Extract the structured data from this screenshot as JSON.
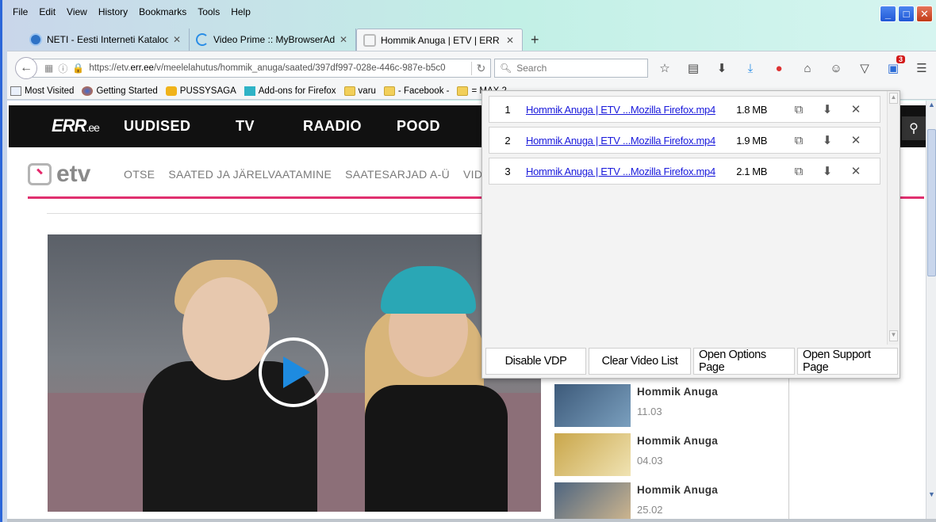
{
  "menu": [
    "File",
    "Edit",
    "View",
    "History",
    "Bookmarks",
    "Tools",
    "Help"
  ],
  "tabs": [
    {
      "title": "NETI - Eesti Interneti Kataloo...",
      "color": "#2e72c6"
    },
    {
      "title": "Video Prime :: MyBrowserAdd...",
      "color": "#2a8ee6"
    },
    {
      "title": "Hommik Anuga | ETV | ERR",
      "color": "#e0306f"
    }
  ],
  "urlbar": {
    "prefix": "https://etv.",
    "domain": "err.ee",
    "path": "/v/meelelahutus/hommik_anuga/saated/397df997-028e-446c-987e-b5c0"
  },
  "search": {
    "placeholder": "Search"
  },
  "toolbar": {
    "badge": "3"
  },
  "bookmarks": [
    {
      "label": "Most Visited",
      "type": "page"
    },
    {
      "label": "Getting Started",
      "type": "firefox"
    },
    {
      "label": "PUSSYSAGA",
      "type": "yellow"
    },
    {
      "label": "Add-ons for Firefox",
      "type": "puzzle"
    },
    {
      "label": "varu",
      "type": "folder"
    },
    {
      "label": "- Facebook -",
      "type": "folder"
    },
    {
      "label": "= MAX 2 -",
      "type": "folder"
    }
  ],
  "err": {
    "logo": "ERR",
    "logo_suffix": ".ee",
    "nav": [
      "UUDISED",
      "TV",
      "RAADIO",
      "POOD"
    ]
  },
  "etv": {
    "logo": "etv",
    "nav": [
      "OTSE",
      "SAATED JA JÄRELVAATAMINE",
      "SAATESARJAD A-Ü",
      "VIDEOD"
    ]
  },
  "related": [
    {
      "name": "Hommik Anuga",
      "date": "11.03"
    },
    {
      "name": "Hommik Anuga",
      "date": "04.03"
    },
    {
      "name": "Hommik Anuga",
      "date": "25.02"
    }
  ],
  "downloads": [
    {
      "num": "1",
      "name": "Hommik Anuga | ETV ...Mozilla Firefox.mp4",
      "size": "1.8 MB"
    },
    {
      "num": "2",
      "name": "Hommik Anuga | ETV ...Mozilla Firefox.mp4",
      "size": "1.9 MB"
    },
    {
      "num": "3",
      "name": "Hommik Anuga | ETV ...Mozilla Firefox.mp4",
      "size": "2.1 MB"
    }
  ],
  "popup_buttons": {
    "disable": "Disable VDP",
    "clear": "Clear Video List",
    "options": "Open Options Page",
    "support": "Open Support Page"
  }
}
